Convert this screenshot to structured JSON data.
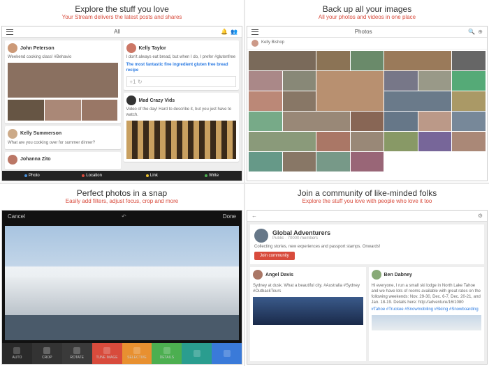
{
  "panels": {
    "p1": {
      "title": "Explore the stuff you love",
      "subtitle": "Your Stream delivers the latest posts and shares",
      "tab": "All",
      "share": {
        "photo": "Photo",
        "location": "Location",
        "link": "Link",
        "write": "Write"
      },
      "post1": {
        "author": "John Peterson",
        "text": "Weekend cooking class! #Behavio"
      },
      "post2": {
        "author": "Kelly Taylor",
        "text": "I don't always eat bread, but when I do, I prefer #glutenfree",
        "link": "The most fantastic five ingredient gluten free bread recipe"
      },
      "post3": {
        "author": "Kelly Summerson",
        "text": "What are you cooking over for summer dinner?"
      },
      "post4": {
        "author": "Johanna Zito"
      },
      "post5": {
        "author": "Mad Crazy Vids",
        "text": "Video of the day! Hard to describe it, but you just have to watch."
      }
    },
    "p2": {
      "title": "Back up all your images",
      "subtitle": "All your photos and videos in one place",
      "tab": "Photos",
      "user": "Kelly Bishop"
    },
    "p3": {
      "title": "Perfect photos in a snap",
      "subtitle": "Easily add filters, adjust focus, crop and more",
      "cancel": "Cancel",
      "done": "Done",
      "tools": [
        "AUTO",
        "CROP",
        "ROTATE",
        "TUNE IMAGE",
        "SELECTIVE",
        "DETAILS",
        "—",
        "—"
      ]
    },
    "p4": {
      "title": "Join a community of like-minded folks",
      "subtitle": "Explore the stuff you love with people who love it too",
      "group": "Global Adventurers",
      "members": "Public · 70000 members",
      "desc": "Collecting stories, new experiences and passport stamps. Onwards!",
      "join": "Join community",
      "c1": {
        "author": "Angel Davis",
        "text": "Sydney at dusk. What a beautiful city. #Australia #Sydney #OutbackTours"
      },
      "c2": {
        "author": "Ben Dabney",
        "text": "Hi everyone, I run a small ski lodge in North Lake Tahoe and we have lots of rooms available with great rates on the following weekends: Nov. 29-30, Dec. 6-7, Dec. 20-21, and Jan. 18-19. Details here: http://adventure/16/1080",
        "tags": "#Tahoe #Truckee #Snowmobiling #Skiing #Snowboarding"
      }
    }
  },
  "colors": {
    "red": "#d84b3c",
    "blue": "#2a7ae2",
    "dark": "#222"
  }
}
